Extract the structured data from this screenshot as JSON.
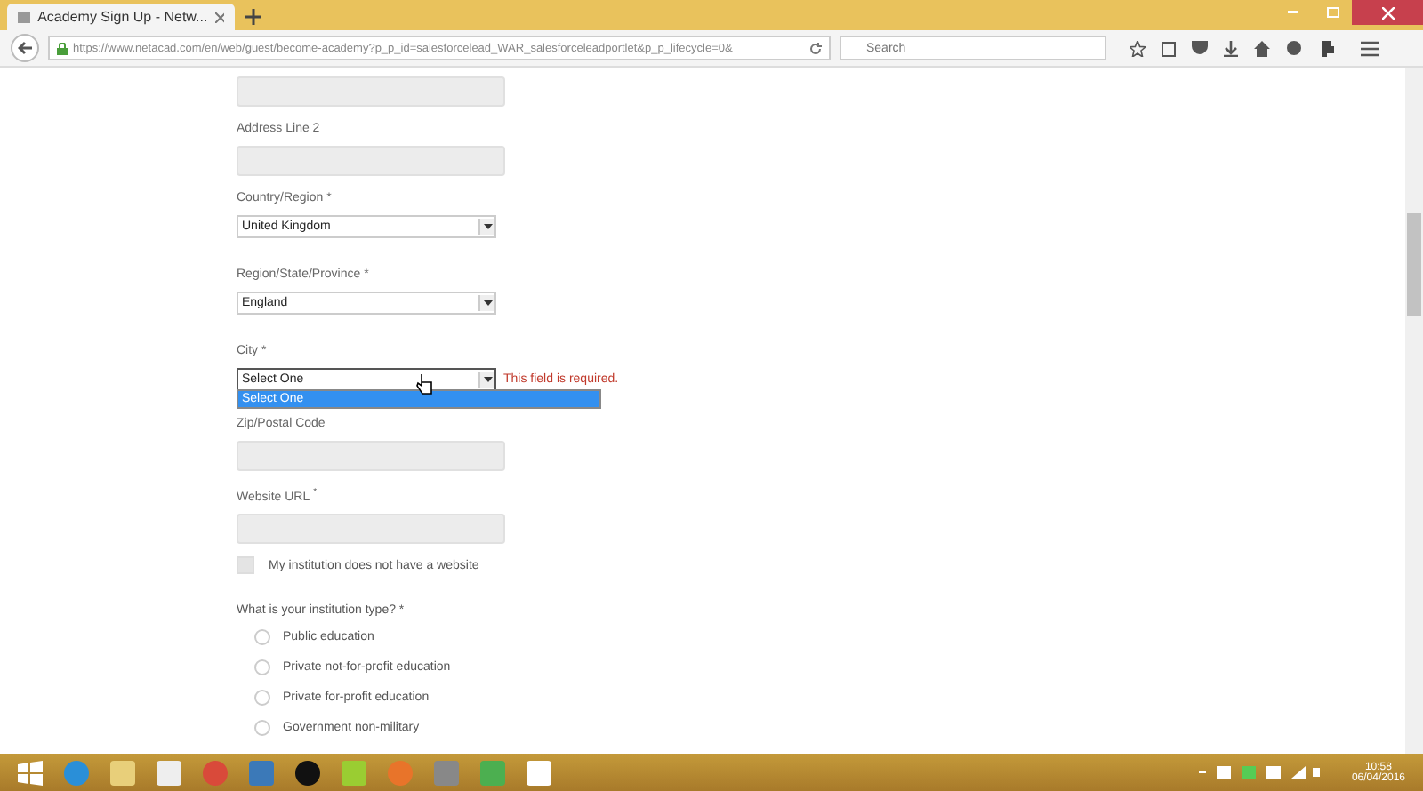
{
  "browser": {
    "tab_title": "Academy Sign Up - Netw...",
    "url": "https://www.netacad.com/en/web/guest/become-academy?p_p_id=salesforcelead_WAR_salesforceleadportlet&p_p_lifecycle=0&",
    "search_placeholder": "Search"
  },
  "form": [
    {
      "kind": "text"
    },
    {
      "kind": "text",
      "label": "Address Line 2"
    },
    {
      "kind": "select",
      "label": "Country/Region *",
      "value": "United Kingdom",
      "open": false
    },
    {
      "kind": "select",
      "label": "Region/State/Province *",
      "value": "England",
      "open": false
    },
    {
      "kind": "select",
      "label": "City *",
      "value": "Select One",
      "error": "This field is required.",
      "open": true,
      "options": [
        {
          "label": "Select One",
          "selected": true
        }
      ]
    },
    {
      "kind": "text",
      "label": "Zip/Postal Code"
    },
    {
      "kind": "text",
      "label": "Website URL",
      "required_mark": "*"
    },
    {
      "kind": "checkbox",
      "label": "My institution does not have a website",
      "checked": false
    }
  ],
  "institution_type": {
    "question": "What is your institution type? *",
    "options": [
      {
        "label": "Public education",
        "selected": false
      },
      {
        "label": "Private not-for-profit education",
        "selected": false
      },
      {
        "label": "Private for-profit education",
        "selected": false
      },
      {
        "label": "Government non-military",
        "selected": false
      }
    ]
  },
  "taskbar": {
    "time": "10:58",
    "date": "06/04/2016"
  }
}
